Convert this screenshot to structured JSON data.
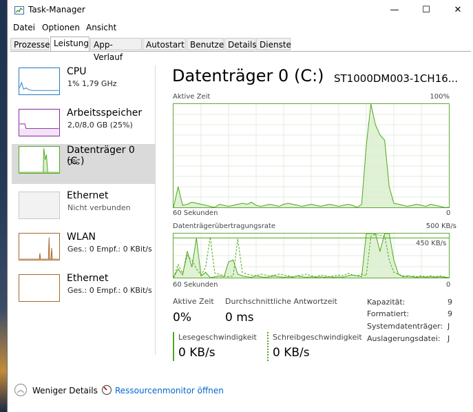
{
  "window": {
    "title": "Task-Manager",
    "minimize_glyph": "—",
    "maximize_glyph": "☐",
    "close_glyph": "✕"
  },
  "menu": [
    "Datei",
    "Optionen",
    "Ansicht"
  ],
  "tabs": [
    {
      "label": "Prozesse",
      "active": false
    },
    {
      "label": "Leistung",
      "active": true
    },
    {
      "label": "App-Verlauf",
      "active": false
    },
    {
      "label": "Autostart",
      "active": false
    },
    {
      "label": "Benutzer",
      "active": false
    },
    {
      "label": "Details",
      "active": false
    },
    {
      "label": "Dienste",
      "active": false
    }
  ],
  "sidebar": {
    "items": [
      {
        "title": "CPU",
        "sub": "1% 1,79 GHz",
        "color": "#1f7ac4"
      },
      {
        "title": "Arbeitsspeicher",
        "sub": "2,0/8,0 GB (25%)",
        "color": "#8b21a6"
      },
      {
        "title": "Datenträger 0 (C:)",
        "sub": "0%",
        "color": "#4da61a"
      },
      {
        "title": "Ethernet",
        "sub": "Nicht verbunden",
        "color": "#b0b0b0"
      },
      {
        "title": "WLAN",
        "sub": "Ges.: 0 Empf.: 0 KBit/s",
        "color": "#a7652a"
      },
      {
        "title": "Ethernet",
        "sub": "Ges.: 0 Empf.: 0 KBit/s",
        "color": "#a7652a"
      }
    ]
  },
  "main": {
    "title": "Datenträger 0 (C:)",
    "model": "ST1000DM003-1CH16...",
    "chart1": {
      "label": "Aktive Zeit",
      "max": "100%",
      "xlabel": "60 Sekunden",
      "min": "0"
    },
    "chart2": {
      "label": "Datenträgerübertragungsrate",
      "max": "500 KB/s",
      "line_label": "450 KB/s",
      "xlabel": "60 Sekunden",
      "min": "0"
    },
    "stats": {
      "active_label": "Aktive Zeit",
      "active_value": "0%",
      "resp_label": "Durchschnittliche Antwortzeit",
      "resp_value": "0 ms",
      "read_label": "Lesegeschwindigkeit",
      "read_value": "0 KB/s",
      "write_label": "Schreibgeschwindigkeit",
      "write_value": "0 KB/s"
    },
    "props": [
      {
        "label": "Kapazität:",
        "value": "9"
      },
      {
        "label": "Formatiert:",
        "value": "9"
      },
      {
        "label": "Systemdatenträger:",
        "value": "J"
      },
      {
        "label": "Auslagerungsdatei:",
        "value": "J"
      }
    ]
  },
  "bottom": {
    "fewer_details": "Weniger Details",
    "resource_monitor": "Ressourcenmonitor öffnen"
  },
  "chart_data": [
    {
      "type": "area",
      "title": "Aktive Zeit",
      "xlabel": "60 Sekunden",
      "ylim": [
        0,
        100
      ],
      "x": [
        0,
        1,
        2,
        3,
        4,
        5,
        6,
        7,
        8,
        9,
        10,
        11,
        12,
        13,
        14,
        15,
        16,
        17,
        18,
        19,
        20,
        21,
        22,
        23,
        24,
        25,
        26,
        27,
        28,
        29,
        30,
        31,
        32,
        33,
        34,
        35,
        36,
        37,
        38,
        39,
        40,
        41,
        42,
        43,
        44,
        45,
        46,
        47,
        48,
        49,
        50,
        51,
        52,
        53,
        54,
        55,
        56,
        57,
        58,
        59,
        60
      ],
      "series": [
        {
          "values": [
            0,
            20,
            2,
            3,
            5,
            4,
            3,
            2,
            1,
            0,
            3,
            2,
            1,
            2,
            3,
            4,
            3,
            5,
            2,
            1,
            2,
            3,
            2,
            1,
            3,
            4,
            3,
            2,
            1,
            2,
            3,
            2,
            1,
            2,
            3,
            2,
            1,
            2,
            3,
            2,
            0,
            3,
            60,
            100,
            80,
            70,
            65,
            20,
            4,
            3,
            2,
            1,
            2,
            3,
            2,
            1,
            3,
            2,
            1,
            0,
            0
          ]
        }
      ]
    },
    {
      "type": "line",
      "title": "Datenträgerübertragungsrate",
      "xlabel": "60 Sekunden",
      "ylim": [
        0,
        500
      ],
      "x": [
        0,
        1,
        2,
        3,
        4,
        5,
        6,
        7,
        8,
        9,
        10,
        11,
        12,
        13,
        14,
        15,
        16,
        17,
        18,
        19,
        20,
        21,
        22,
        23,
        24,
        25,
        26,
        27,
        28,
        29,
        30,
        31,
        32,
        33,
        34,
        35,
        36,
        37,
        38,
        39,
        40,
        41,
        42,
        43,
        44,
        45,
        46,
        47,
        48,
        49,
        50,
        51,
        52,
        53,
        54,
        55,
        56,
        57,
        58,
        59,
        60
      ],
      "series": [
        {
          "values": [
            0,
            100,
            30,
            300,
            120,
            450,
            20,
            60,
            0,
            10,
            20,
            10,
            180,
            200,
            40,
            20,
            10,
            5,
            20,
            10,
            5,
            10,
            20,
            10,
            5,
            10,
            5,
            20,
            10,
            5,
            10,
            5,
            10,
            5,
            10,
            5,
            10,
            5,
            20,
            30,
            20,
            10,
            500,
            500,
            500,
            300,
            500,
            500,
            200,
            40,
            10,
            20,
            10,
            5,
            10,
            5,
            10,
            5,
            10,
            5,
            0
          ]
        },
        {
          "values": [
            0,
            150,
            50,
            250,
            200,
            100,
            30,
            120,
            460,
            50,
            40,
            20,
            10,
            20,
            440,
            60,
            40,
            30,
            20,
            40,
            30,
            20,
            30,
            40,
            30,
            20,
            10,
            20,
            30,
            40,
            20,
            10,
            30,
            20,
            10,
            20,
            30,
            20,
            50,
            30,
            20,
            40,
            20,
            470,
            490,
            480,
            470,
            200,
            60,
            40,
            20,
            10,
            20,
            10,
            20,
            10,
            20,
            10,
            20,
            10,
            0
          ]
        }
      ]
    }
  ]
}
